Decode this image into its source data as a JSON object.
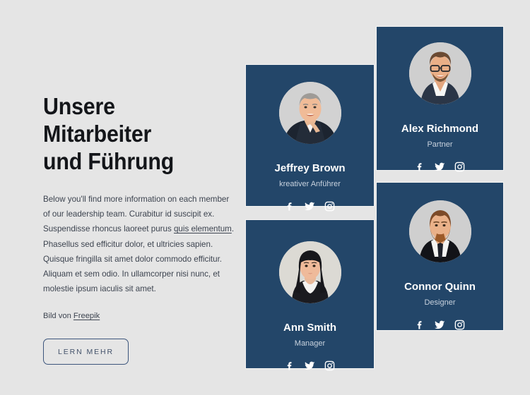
{
  "intro": {
    "heading": "Unsere Mitarbeiter\nund Führung",
    "body_before_link": "Below you'll find more information on each member of our leadership team. Curabitur id suscipit ex. Suspendisse rhoncus laoreet purus ",
    "body_link": "quis elementum",
    "body_after_link": ". Phasellus sed efficitur dolor, et ultricies sapien. Quisque fringilla sit amet dolor commodo efficitur. Aliquam et sem odio. In ullamcorper nisi nunc, et molestie ipsum iaculis sit amet.",
    "credit_prefix": "Bild von ",
    "credit_link": "Freepik",
    "cta_label": "LERN MEHR"
  },
  "cards": [
    {
      "name": "Jeffrey Brown",
      "role": "kreativer Anführer",
      "socials": [
        "facebook-icon",
        "twitter-icon",
        "instagram-icon"
      ]
    },
    {
      "name": "Ann Smith",
      "role": "Manager",
      "socials": [
        "facebook-icon",
        "twitter-icon",
        "instagram-icon"
      ]
    },
    {
      "name": "Alex Richmond",
      "role": "Partner",
      "socials": [
        "facebook-icon",
        "twitter-icon",
        "instagram-icon"
      ]
    },
    {
      "name": "Connor Quinn",
      "role": "Designer",
      "socials": [
        "facebook-icon",
        "twitter-icon",
        "instagram-icon"
      ]
    }
  ],
  "colors": {
    "page_background": "#e5e5e5",
    "card_background": "#234669",
    "heading_text": "#14161a",
    "body_text": "#3d4450",
    "card_name_text": "#ffffff",
    "card_role_text": "#c8d2de",
    "button_border": "#3c557c",
    "avatar_background": "#d2d2d2"
  }
}
